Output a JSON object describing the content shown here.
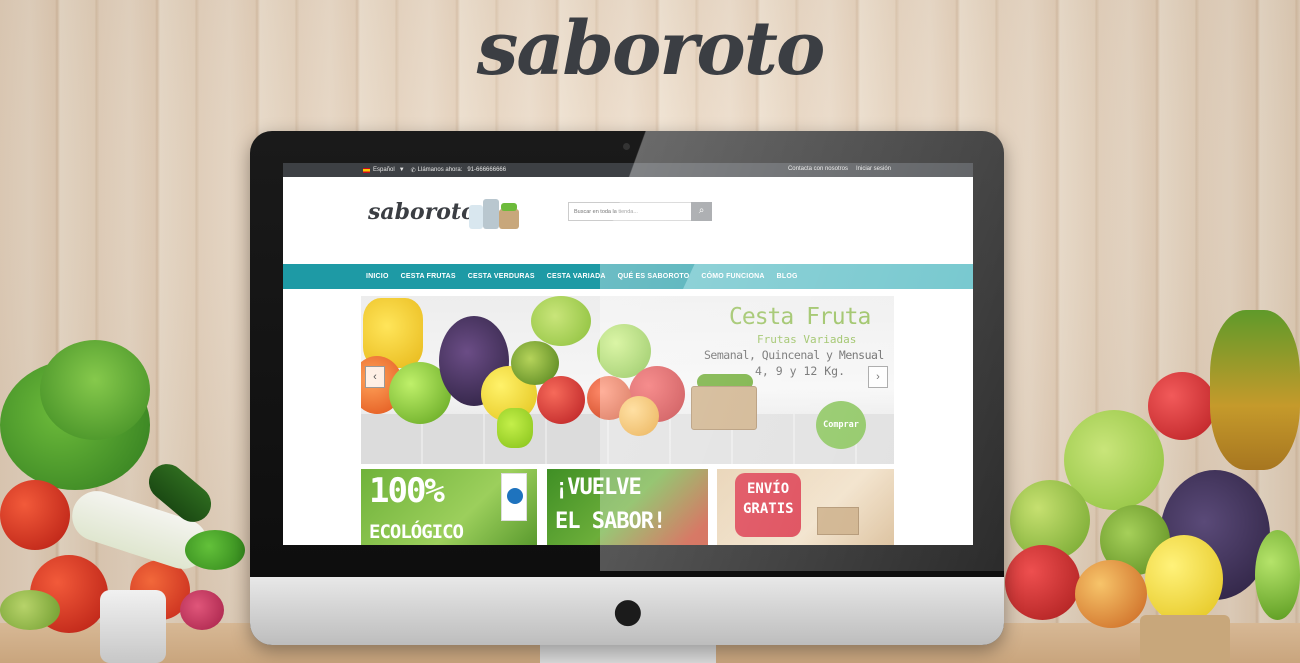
{
  "brand": {
    "logo_text": "saboroto"
  },
  "screen": {
    "topbar": {
      "language": "Español",
      "call_label": "Llámanos ahora:",
      "phone": "91-666666666",
      "contact_link": "Contacta con nosotros",
      "login_link": "Iniciar sesión"
    },
    "header": {
      "logo_text": "saboroto",
      "search_placeholder": "Buscar en toda la tienda..."
    },
    "nav": [
      {
        "label": "INICIO"
      },
      {
        "label": "CESTA FRUTAS"
      },
      {
        "label": "CESTA VERDURAS"
      },
      {
        "label": "CESTA VARIADA"
      },
      {
        "label": "QUÉ ES SABOROTO"
      },
      {
        "label": "CÓMO FUNCIONA"
      },
      {
        "label": "BLOG"
      }
    ],
    "slider": {
      "title": "Cesta Fruta",
      "subtitle": "Frutas Variadas",
      "frequency": "Semanal, Quincenal y Mensual",
      "sizes": "4, 9 y 12 Kg.",
      "button": "Comprar",
      "prev_icon": "chevron-left-icon",
      "next_icon": "chevron-right-icon"
    },
    "promos": [
      {
        "line1": "100%",
        "line2": "ECOLÓGICO"
      },
      {
        "line1": "¡VUELVE",
        "line2": "EL SABOR!"
      },
      {
        "line1": "ENVÍO",
        "line2": "GRATIS"
      }
    ]
  },
  "colors": {
    "nav_primary": "#1e9aa5",
    "nav_secondary": "#5bbdc5",
    "topbar": "#3d4044",
    "accent_green": "#8bb84a",
    "promo_red": "#d8293a"
  }
}
